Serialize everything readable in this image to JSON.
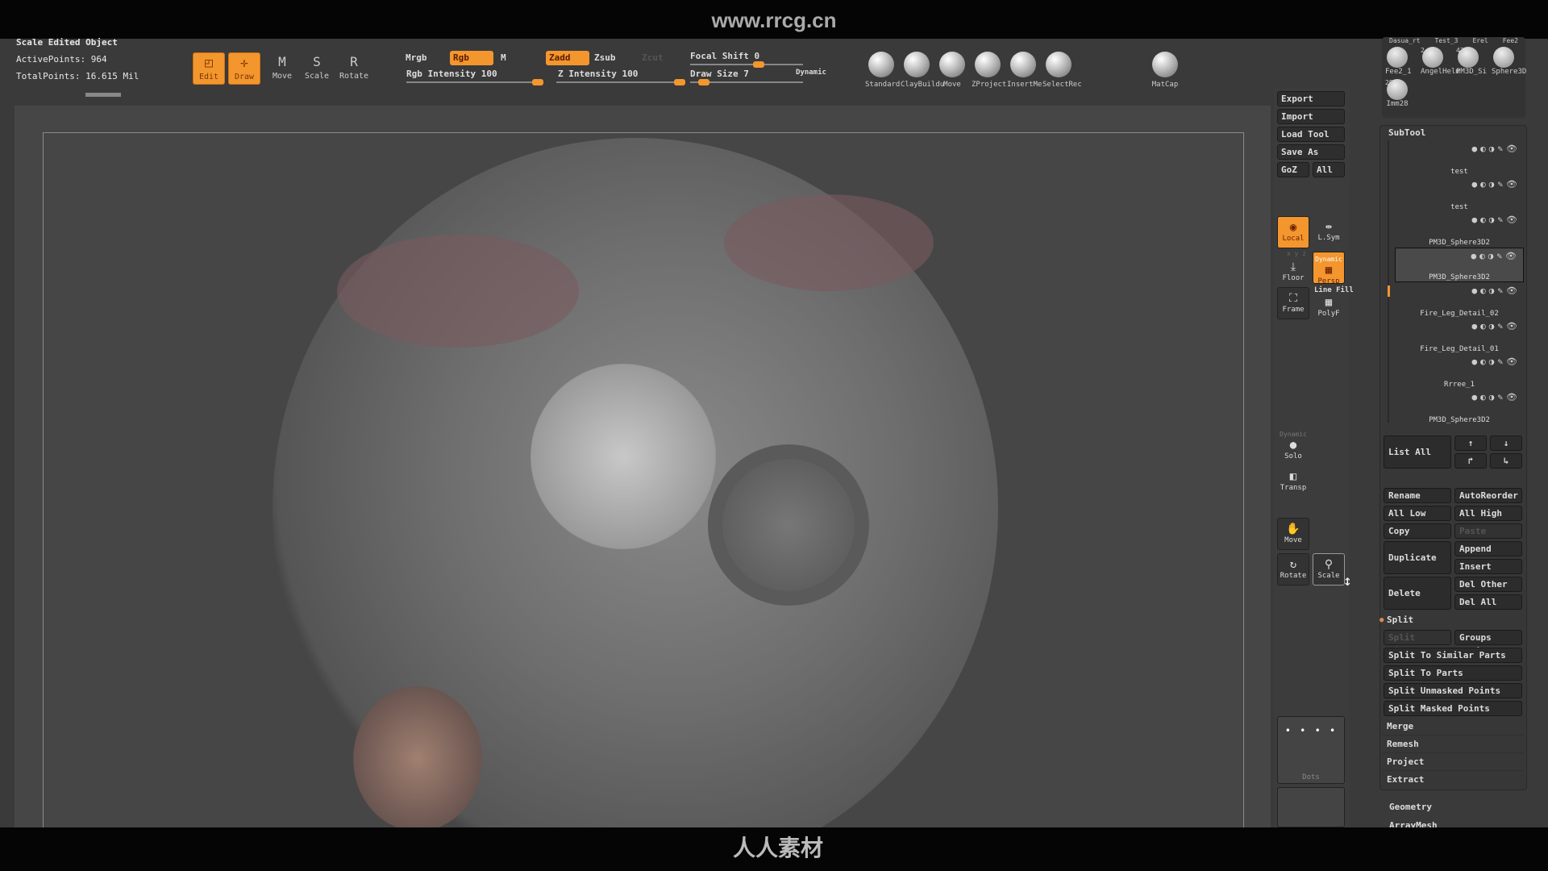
{
  "watermark": "www.rrcg.cn",
  "bottom_logo": "人人素材",
  "status": {
    "title": "Scale Edited Object",
    "active_points": "ActivePoints: 964",
    "total_points": "TotalPoints: 16.615 Mil"
  },
  "tools": [
    {
      "label": "Edit",
      "glyph": "◰",
      "active": true
    },
    {
      "label": "Draw",
      "glyph": "✛",
      "active": true
    },
    {
      "label": "Move",
      "glyph": "M",
      "active": false
    },
    {
      "label": "Scale",
      "glyph": "S",
      "active": false
    },
    {
      "label": "Rotate",
      "glyph": "R",
      "active": false
    }
  ],
  "color_mode": {
    "mrgb": "Mrgb",
    "rgb": "Rgb",
    "m": "M",
    "rgb_intensity": "Rgb Intensity 100",
    "rgb_intensity_value": 100
  },
  "z_mode": {
    "zadd": "Zadd",
    "zsub": "Zsub",
    "zcut": "Zcut",
    "z_intensity": "Z Intensity 100",
    "z_intensity_value": 100
  },
  "focal": {
    "focal_shift": "Focal Shift 0",
    "draw_size": "Draw Size 7",
    "dynamic": "Dynamic"
  },
  "brushes": [
    "Standard",
    "ClayBuildu",
    "Move",
    "ZProject",
    "InsertMe",
    "SelectRec"
  ],
  "matcap": "MatCap",
  "tool_thumbs": {
    "top_labels": [
      "Dasua_rt",
      "Test_3",
      "Erel",
      "Fee2"
    ],
    "items": [
      {
        "label": "Fee2_1",
        "count": ""
      },
      {
        "label": "AngelHelm",
        "count": "2"
      },
      {
        "label": "PM3D_Si",
        "count": "42"
      },
      {
        "label": "Sphere3D",
        "count": ""
      },
      {
        "label": "Imm28",
        "count": "29"
      }
    ]
  },
  "shelf": {
    "export": "Export",
    "import": "Import",
    "load_tool": "Load Tool",
    "save_as": "Save As",
    "goz": "GoZ",
    "all": "All",
    "local": "Local",
    "lsym": "L.Sym",
    "xyz": "x y z",
    "floor": "Floor",
    "dynamic": "Dynamic",
    "persp": "Persp",
    "line_fill": "Line Fill",
    "polyf": "PolyF",
    "frame": "Frame",
    "solo_dynamic": "Dynamic",
    "solo": "Solo",
    "transp": "Transp",
    "move": "Move",
    "rotate": "Rotate",
    "scale": "Scale",
    "dots": "Dots"
  },
  "subtool": {
    "title": "SubTool",
    "items": [
      {
        "name": "test",
        "selected": false
      },
      {
        "name": "test",
        "selected": false
      },
      {
        "name": "PM3D_Sphere3D2",
        "selected": false
      },
      {
        "name": "PM3D_Sphere3D2",
        "selected": true
      },
      {
        "name": "Fire_Leg_Detail_02",
        "selected": false
      },
      {
        "name": "Fire_Leg_Detail_01",
        "selected": false
      },
      {
        "name": "Rrree_1",
        "selected": false
      },
      {
        "name": "PM3D_Sphere3D2",
        "selected": false
      }
    ],
    "list_all": "List All",
    "rename": "Rename",
    "autoreorder": "AutoReorder",
    "all_low": "All Low",
    "all_high": "All High",
    "copy": "Copy",
    "paste": "Paste",
    "duplicate": "Duplicate",
    "append": "Append",
    "insert": "Insert",
    "delete": "Delete",
    "del_other": "Del Other",
    "del_all": "Del All",
    "split": "Split",
    "split_hidden": "Split Hidden",
    "groups_split": "Groups Split",
    "split_similar": "Split To Similar Parts",
    "split_parts": "Split To Parts",
    "split_unmasked": "Split Unmasked Points",
    "split_masked": "Split Masked Points",
    "merge": "Merge",
    "remesh": "Remesh",
    "project": "Project",
    "extract": "Extract",
    "geometry": "Geometry",
    "arraymesh": "ArrayMesh"
  },
  "colors": {
    "accent": "#f3962e",
    "bg": "#3a3a3a"
  }
}
